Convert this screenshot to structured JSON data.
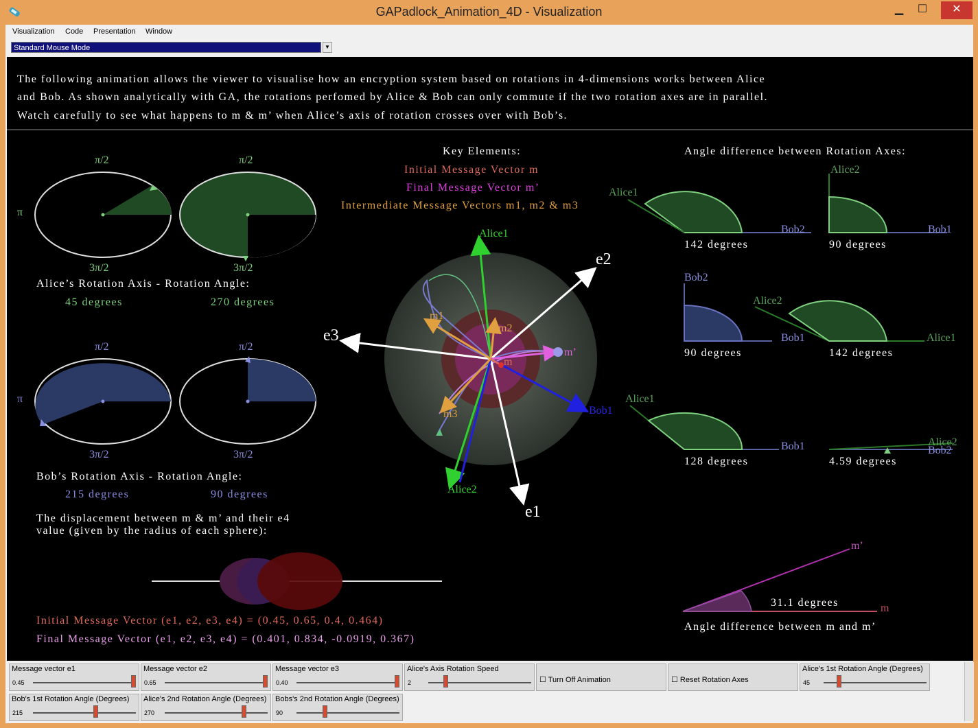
{
  "window": {
    "title": "GAPadlock_Animation_4D - Visualization",
    "min": "▁",
    "max": "☐",
    "close": "✕"
  },
  "menu": [
    "Visualization",
    "Code",
    "Presentation",
    "Window"
  ],
  "mode": {
    "selected": "Standard Mouse Mode"
  },
  "intro": [
    "The following animation allows the viewer to visualise how an encryption system based on rotations in 4-dimensions works between Alice",
    "and Bob. As shown analytically with GA, the rotations perfomed by Alice & Bob can only commute if the two rotation axes are in parallel.",
    "Watch carefully to see what happens to m & m’ when Alice’s axis of rotation crosses over with Bob’s."
  ],
  "alice_panel": {
    "dial_top": "π/2",
    "dial_bottom": "3π/2",
    "dial_left": "π",
    "heading": "Alice’s Rotation Axis - Rotation Angle:",
    "angle1": "45 degrees",
    "angle2": "270 degrees"
  },
  "bob_panel": {
    "dial_top": "π/2",
    "dial_bottom": "3π/2",
    "dial_left": "π",
    "heading": "Bob’s Rotation Axis - Rotation Angle:",
    "angle1": "215 degrees",
    "angle2": "90 degrees"
  },
  "displacement": {
    "line1": "The displacement between m & m’ and their e4",
    "line2": "value (given by the radius of each sphere):"
  },
  "vectors": {
    "initial": "Initial Message Vector (e1, e2, e3, e4) = (0.45, 0.65, 0.4, 0.464)",
    "final": "Final Message Vector (e1, e2, e3, e4) = (0.401, 0.834, -0.0919, 0.367)"
  },
  "key": {
    "heading": "Key Elements:",
    "initial": "Initial Message Vector m",
    "final": "Final Message Vector m’",
    "intermediate": "Intermediate Message Vectors m1, m2 & m3"
  },
  "scene": {
    "e1": "e1",
    "e2": "e2",
    "e3": "e3",
    "alice1": "Alice1",
    "alice2": "Alice2",
    "bob1": "Bob1",
    "m1": "m1",
    "m2": "m2",
    "m3": "m3",
    "m": "m",
    "mprime": "m’"
  },
  "angles_panel": {
    "heading": "Angle difference between Rotation Axes:",
    "g1": {
      "a": "Alice1",
      "b": "Bob2",
      "deg": "142 degrees"
    },
    "g2": {
      "a": "Alice2",
      "b": "Bob1",
      "deg": "90 degrees"
    },
    "g3": {
      "a": "Bob2",
      "b": "Bob1",
      "deg": "90 degrees"
    },
    "g4": {
      "a": "Alice2",
      "b": "Alice1",
      "deg": "142 degrees"
    },
    "g5": {
      "a": "Alice1",
      "b": "Bob1",
      "deg": "128 degrees"
    },
    "g6": {
      "a": "Alice2",
      "b": "Bob2",
      "deg": "4.59 degrees"
    },
    "mm": {
      "label_m": "m",
      "label_mp": "m’",
      "deg": "31.1 degrees",
      "caption": "Angle difference between m and m’"
    }
  },
  "controls": [
    {
      "label": "Message vector e1",
      "value": "0.45"
    },
    {
      "label": "Message vector e2",
      "value": "0.65"
    },
    {
      "label": "Message vector e3",
      "value": "0.40"
    },
    {
      "label": "Alice's Axis Rotation Speed",
      "value": "2"
    },
    {
      "label": "Turn Off Animation"
    },
    {
      "label": "Reset Rotation Axes"
    },
    {
      "label": "Alice's 1st Rotation Angle (Degrees)",
      "value": "45"
    },
    {
      "label": "Bob's 1st Rotation Angle (Degrees)",
      "value": "215"
    },
    {
      "label": "Alice's 2nd Rotation Angle (Degrees)",
      "value": "270"
    },
    {
      "label": "Bobs's 2nd Rotation Angle (Degrees)",
      "value": "90"
    }
  ],
  "colors": {
    "alice_green": "#1f4a24",
    "bob_blue": "#2a3a64",
    "m_red": "#e06a5a",
    "mprime_pink": "#e060e0",
    "mid_orange": "#e0a040"
  }
}
